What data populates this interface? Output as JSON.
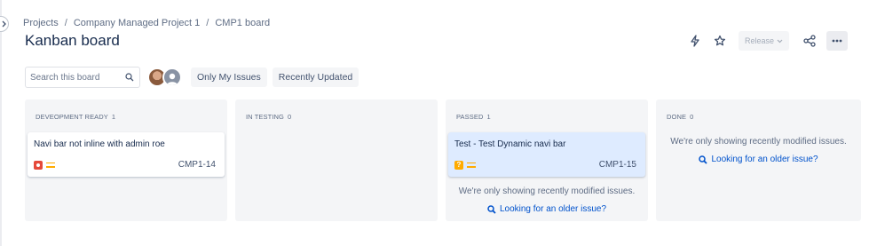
{
  "breadcrumb": [
    "Projects",
    "Company Managed Project 1",
    "CMP1 board"
  ],
  "breadcrumb_separator": "/",
  "title": "Kanban board",
  "header": {
    "release_label": "Release",
    "icons": [
      "lightning-icon",
      "star-icon",
      "share-icon",
      "more-icon"
    ]
  },
  "toolbar": {
    "search_placeholder": "Search this board",
    "filters": [
      "Only My Issues",
      "Recently Updated"
    ]
  },
  "columns": [
    {
      "name": "DEVEOPMENT READY",
      "count": "1",
      "cards": [
        {
          "title": "Navi bar not inline with admin roe",
          "key": "CMP1-14",
          "type": "bug",
          "priority": "medium"
        }
      ]
    },
    {
      "name": "IN TESTING",
      "count": "0",
      "cards": []
    },
    {
      "name": "PASSED",
      "count": "1",
      "cards": [
        {
          "title": "Test - Test Dynamic navi bar",
          "key": "CMP1-15",
          "type": "question",
          "type_glyph": "?",
          "priority": "medium"
        }
      ],
      "note": "We're only showing recently modified issues.",
      "link": "Looking for an older issue?"
    },
    {
      "name": "DONE",
      "count": "0",
      "cards": [],
      "note": "We're only showing recently modified issues.",
      "link": "Looking for an older issue?"
    }
  ],
  "colors": {
    "link": "#0052cc",
    "column_bg": "#f4f5f7",
    "selected_card": "#deebff",
    "bug": "#e5493a",
    "priority_medium": "#ffab00"
  }
}
